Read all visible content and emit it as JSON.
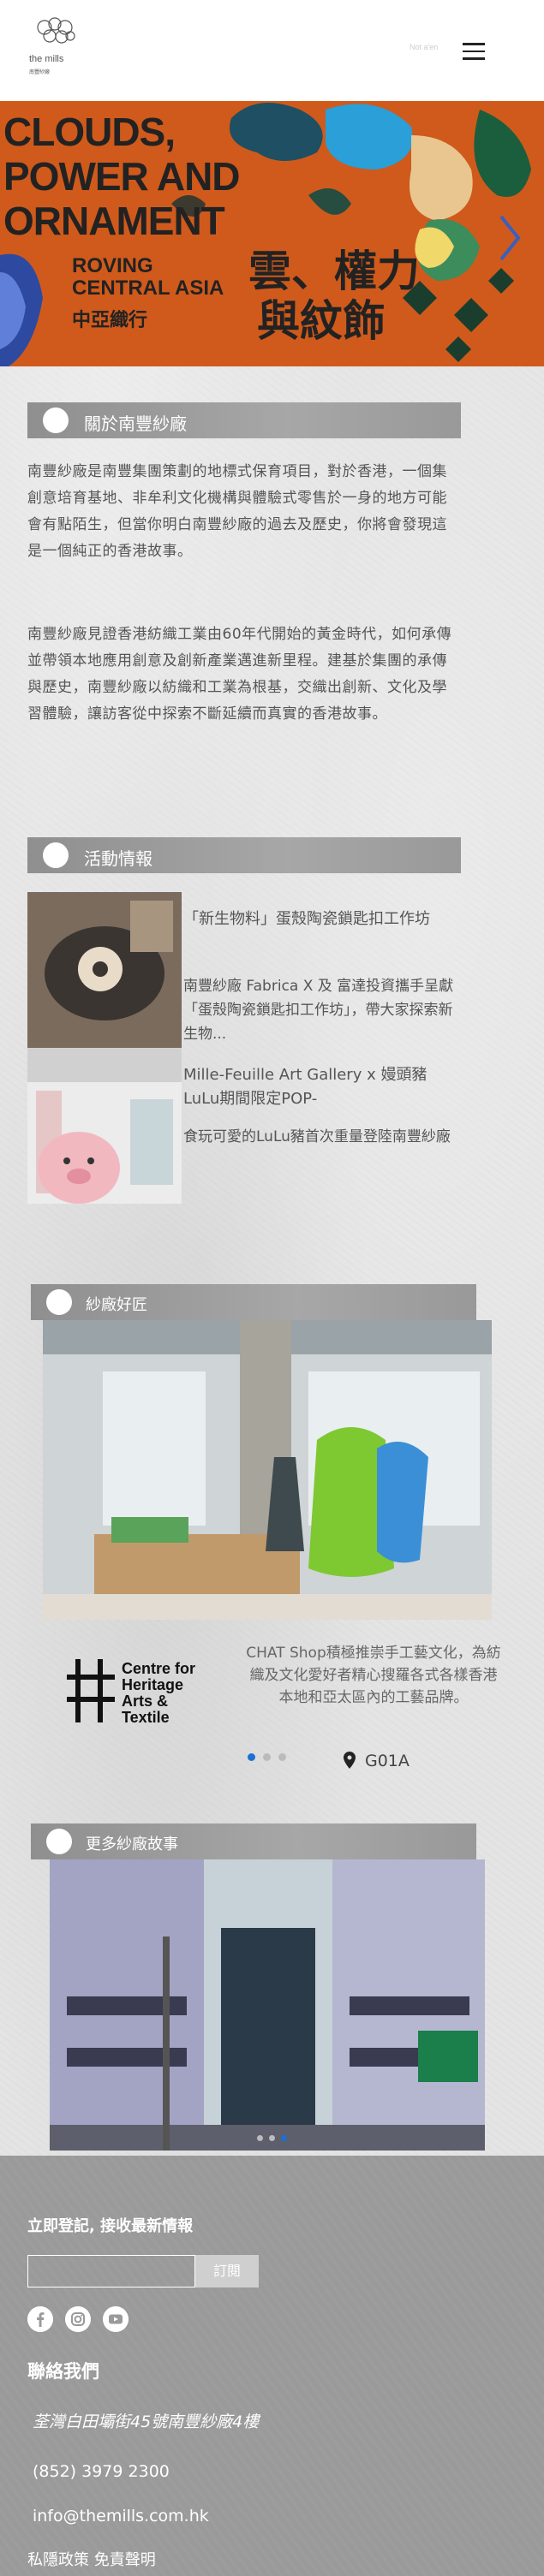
{
  "header": {
    "logo_text": "the mills",
    "logo_sub": "南豐紗廠",
    "lang_label": "Not a'en"
  },
  "hero": {
    "title_lines": [
      "CLOUDS,",
      "POWER AND",
      "ORNAMENT"
    ],
    "sub_en_1": "ROVING",
    "sub_en_2": "CENTRAL ASIA",
    "sub_cn": "中亞織行",
    "title_cn_1": "雲、權力",
    "title_cn_2": "與紋飾",
    "colors": {
      "background": "#cf5a1c",
      "accent_blue": "#3b5fc0"
    }
  },
  "about": {
    "heading": "關於南豐紗廠",
    "para1": "南豐紗廠是南豐集團策劃的地標式保育項目，對於香港，一個集創意培育基地、非牟利文化機構與體驗式零售於一身的地方可能會有點陌生，但當你明白南豐紗廠的過去及歷史，你將會發現這是一個純正的香港故事。",
    "para2": "南豐紗廠見證香港紡織工業由60年代開始的黃金時代，如何承傳並帶領本地應用創意及創新產業邁進新里程。建基於集團的承傳與歷史，南豐紗廠以紡織和工業為根基，交織出創新、文化及學習體驗，讓訪客從中探索不斷延續而真實的香港故事。"
  },
  "events": {
    "heading": "活動情報",
    "items": [
      {
        "title": "「新生物料」蛋殼陶瓷鎖匙扣工作坊",
        "desc": "南豐紗廠 Fabrica X 及 富達投資攜手呈獻「蛋殼陶瓷鎖匙扣工作坊」，帶大家探索新生物..."
      },
      {
        "title": "Mille-Feuille Art Gallery x 嫚頭豬LuLu期間限定POP-",
        "desc": "食玩可愛的LuLu豬首次重量登陸南豐紗廠"
      }
    ]
  },
  "shops": {
    "heading": "紗廠好匠",
    "logo_lines": [
      "Centre for",
      "Heritage",
      "Arts &",
      "Textile"
    ],
    "desc": "CHAT Shop積極推崇手工藝文化，為紡織及文化愛好者精心搜羅各式各樣香港本地和亞太區內的工藝品牌。",
    "location": "G01A",
    "dots": 3,
    "active_dot": 0
  },
  "stories": {
    "heading": "更多紗廠故事",
    "dots": 3,
    "active_dot": 2
  },
  "footer": {
    "subscribe_label": "立即登記, 接收最新情報",
    "subscribe_button": "訂閱",
    "social": [
      "facebook-icon",
      "instagram-icon",
      "youtube-icon"
    ],
    "contact_heading": "聯絡我們",
    "address": "荃灣白田壩街45號南豐紗廠4樓",
    "phone": "(852) 3979 2300",
    "email": "info@themills.com.hk",
    "links": "私隱政策 免責聲明"
  }
}
